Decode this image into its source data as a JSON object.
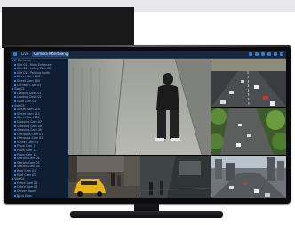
{
  "topbar": {
    "tabs": [
      {
        "label": "Live"
      },
      {
        "label": "Camera Monitoring"
      },
      {
        "label": "x"
      }
    ]
  },
  "sidebar": {
    "items": [
      "IP Cameras",
      "Site 01 - Main Entrance",
      "Site 01 - Lobby Cam 02",
      "Site 01 - Parking North",
      "Street Cam 104",
      "Street Cam 105",
      "Corridor Cam 03",
      "Site 02",
      "Loading Dock 01",
      "Loading Dock 02",
      "Gate Cam 01",
      "Site 03",
      "Street Cam 210",
      "Street Cam 211",
      "Street Cam 212",
      "Crossing Cam 07",
      "Crossing Cam 08",
      "Crossing Cam 09",
      "Overpass Cam 01",
      "Overpass Cam 02",
      "Tunnel Cam 01",
      "Plaza Cam 11",
      "Plaza Cam 12",
      "Plaza Cam 13",
      "Station Cam 04",
      "Station Cam 05",
      "Station Cam 06",
      "Roof Cam 01",
      "Roof Cam 02",
      "Site 04",
      "Office Cam 01",
      "Office Cam 02",
      "Server Room",
      "Back Door",
      "Storage"
    ]
  },
  "colors": {
    "app_bg": "#0e1a2d",
    "accent": "#3b78c6"
  }
}
